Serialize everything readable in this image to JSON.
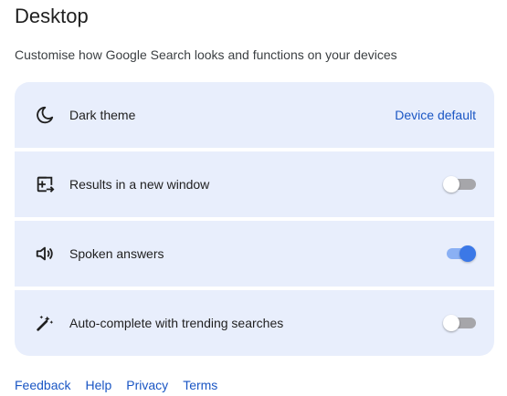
{
  "page": {
    "title": "Desktop",
    "subtitle": "Customise how Google Search looks and functions on your devices"
  },
  "settings": [
    {
      "icon": "moon-icon",
      "label": "Dark theme",
      "value": "Device default"
    },
    {
      "icon": "open-in-new-window-icon",
      "label": "Results in a new window",
      "toggle": "off"
    },
    {
      "icon": "speaker-icon",
      "label": "Spoken answers",
      "toggle": "on"
    },
    {
      "icon": "magic-wand-icon",
      "label": "Auto-complete with trending searches",
      "toggle": "off"
    }
  ],
  "footer": {
    "links": [
      "Feedback",
      "Help",
      "Privacy",
      "Terms"
    ]
  },
  "colors": {
    "card_background": "#e8eefc",
    "link": "#1a56c4",
    "toggle_on": "#3b78e7",
    "toggle_off_track": "#a6a6aa"
  }
}
